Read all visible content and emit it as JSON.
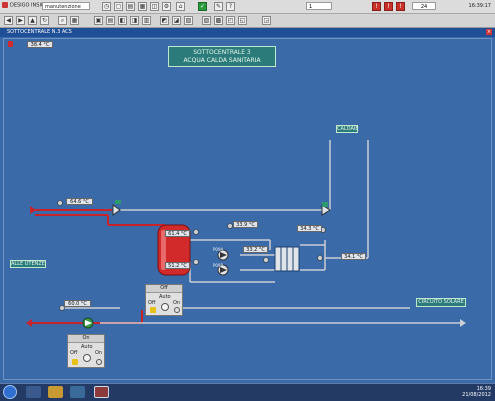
{
  "toolbar": {
    "app_name": "DESIGO INSIGHT",
    "user": "manutenzione",
    "page": "1",
    "alarm": "24",
    "time": "16:39:17"
  },
  "breadcrumb": "SOTTOCENTRALE N.3 ACS",
  "outdoor_temp": "38.4 °C",
  "title": {
    "line1": "SOTTOCENTRALE 3",
    "line2": "ACQUA CALDA SANITARIA"
  },
  "labels": {
    "caldaie": "CALDAIE",
    "utenze": "ALLE UTENZE",
    "solare": "CIRCUITO SOLARE",
    "pump_a": "P09A",
    "pump_b": "P09B"
  },
  "values": {
    "supply_temp": "64.6 °C",
    "tank_top": "61.4 °C",
    "tank_bottom": "51.2 °C",
    "primary_in": "33.9 °C",
    "primary_out": "33.2 °C",
    "hx_a": "34.3 °C",
    "hx_b": "34.1 °C",
    "return_temp": "60.0 °C"
  },
  "panels": {
    "boiler": {
      "state": "Off",
      "mode": "Auto",
      "off": "Off",
      "on": "On"
    },
    "pump": {
      "state": "On",
      "mode": "Auto",
      "off": "Off",
      "on": "On"
    }
  },
  "taskbar": {
    "time": "16:39",
    "date": "21/08/2012"
  },
  "colors": {
    "background": "#3a6aa8",
    "hot_pipe": "#c8232a",
    "cold_pipe": "#c9cdd4",
    "tank": "#d22a2a",
    "label_fill": "#2a7b7a"
  }
}
